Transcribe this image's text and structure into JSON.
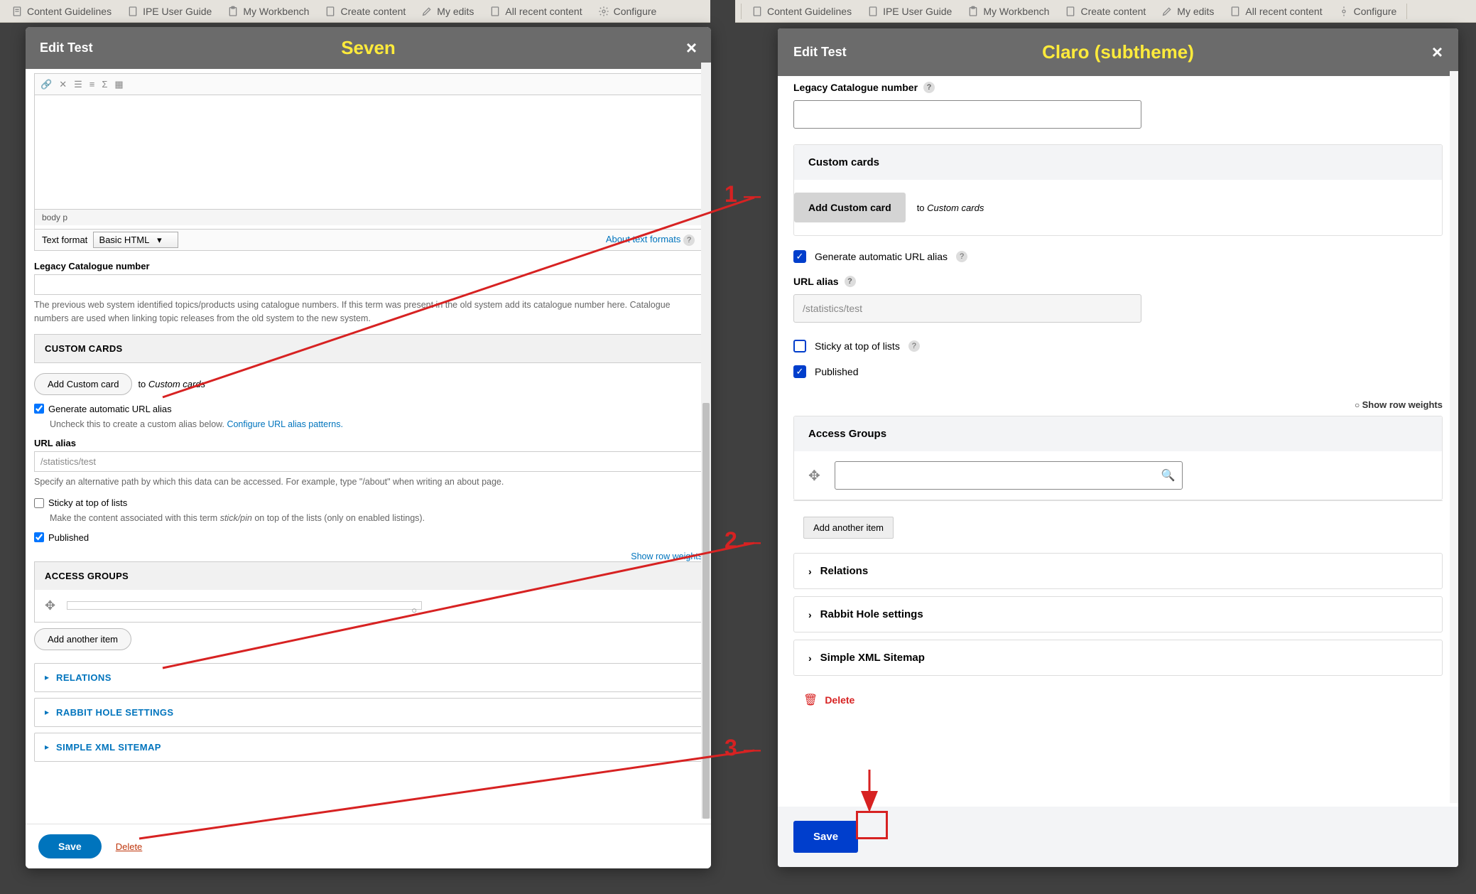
{
  "toolbar": {
    "items": [
      "Content Guidelines",
      "IPE User Guide",
      "My Workbench",
      "Create content",
      "My edits",
      "All recent content",
      "Configure"
    ]
  },
  "seven": {
    "dialog_title": "Edit Test",
    "theme_label": "Seven",
    "editor_footer": "body  p",
    "text_format_label": "Text format",
    "text_format_value": "Basic HTML",
    "about_text_formats": "About text formats",
    "legacy_label": "Legacy Catalogue number",
    "legacy_value": "",
    "legacy_desc": "The previous web system identified topics/products using catalogue numbers. If this term was present in the old system add its catalogue number here. Catalogue numbers are used when linking topic releases from the old system to the new system.",
    "custom_cards_header": "CUSTOM CARDS",
    "add_custom_card": "Add Custom card",
    "to_custom_cards_prefix": "to ",
    "to_custom_cards_em": "Custom cards",
    "gen_alias_label": "Generate automatic URL alias",
    "gen_alias_desc_a": "Uncheck this to create a custom alias below. ",
    "gen_alias_desc_b": "Configure URL alias patterns.",
    "url_alias_label": "URL alias",
    "url_alias_value": "/statistics/test",
    "url_alias_desc": "Specify an alternative path by which this data can be accessed. For example, type \"/about\" when writing an about page.",
    "sticky_label": "Sticky at top of lists",
    "sticky_desc_a": "Make the content associated with this term ",
    "sticky_desc_b": "stick/pin",
    "sticky_desc_c": " on top of the lists (only on enabled listings).",
    "published_label": "Published",
    "show_row_weights": "Show row weights",
    "access_groups_header": "ACCESS GROUPS",
    "add_another_item": "Add another item",
    "details": [
      "RELATIONS",
      "RABBIT HOLE SETTINGS",
      "SIMPLE XML SITEMAP"
    ],
    "save": "Save",
    "delete": "Delete"
  },
  "claro": {
    "dialog_title": "Edit Test",
    "theme_label": "Claro (subtheme)",
    "legacy_label": "Legacy Catalogue number",
    "legacy_value": "",
    "custom_cards_header": "Custom cards",
    "add_custom_card": "Add Custom card",
    "to_custom_cards_prefix": "to ",
    "to_custom_cards_em": "Custom cards",
    "gen_alias_label": "Generate automatic URL alias",
    "url_alias_label": "URL alias",
    "url_alias_value": "/statistics/test",
    "sticky_label": "Sticky at top of lists",
    "published_label": "Published",
    "show_row_weights": "Show row weights",
    "access_groups_header": "Access Groups",
    "add_another_item": "Add another item",
    "details": [
      "Relations",
      "Rabbit Hole settings",
      "Simple XML Sitemap"
    ],
    "save": "Save",
    "delete": "Delete"
  },
  "annotations": {
    "n1": "1",
    "n2": "2",
    "n3": "3"
  }
}
